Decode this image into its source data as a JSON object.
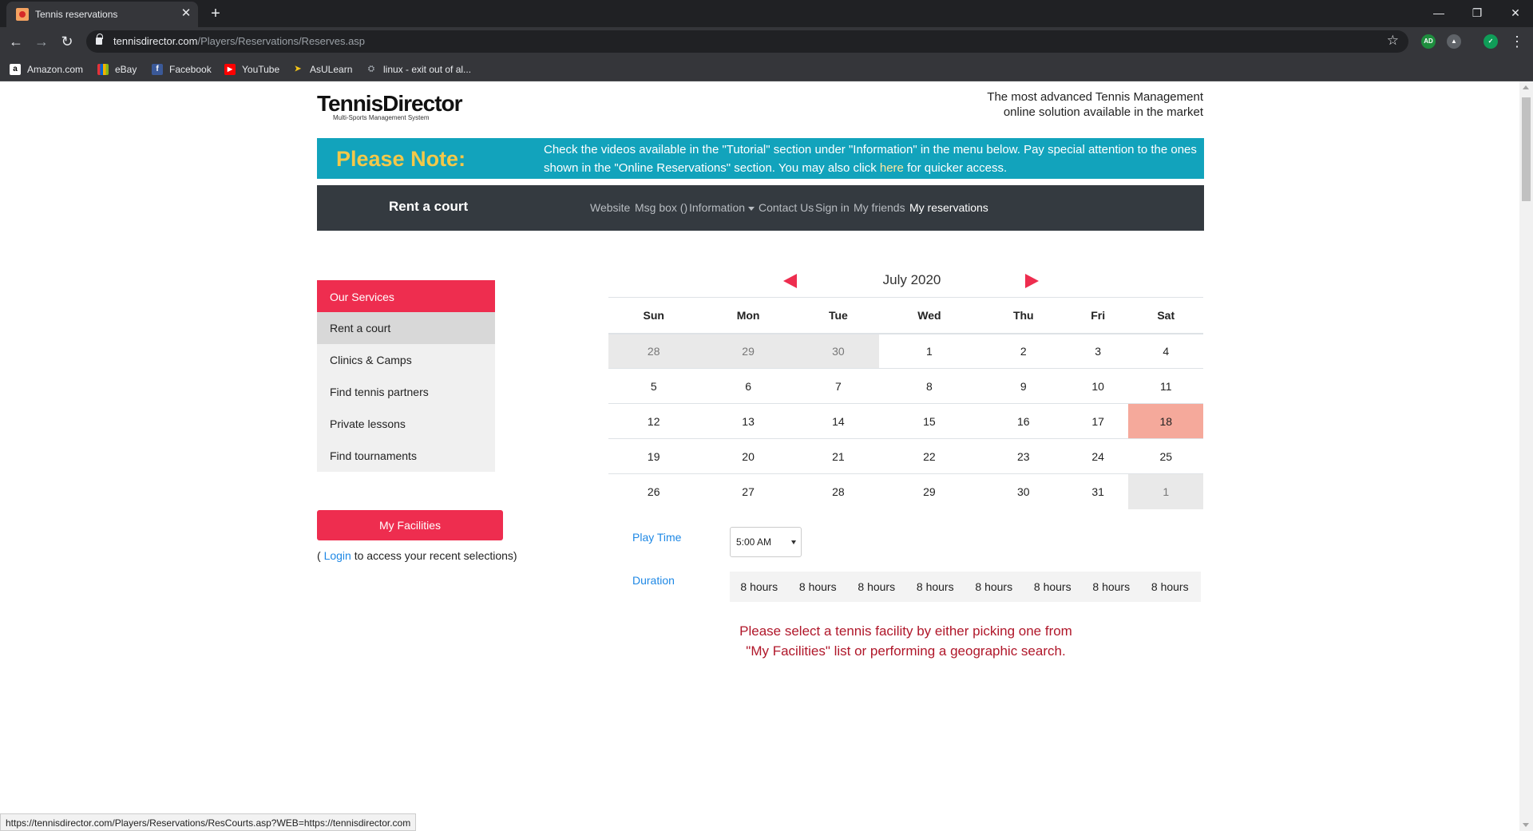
{
  "browser": {
    "tab_title": "Tennis reservations",
    "url_host": "tennisdirector.com",
    "url_path": "/Players/Reservations/Reserves.asp",
    "bookmarks": [
      "Amazon.com",
      "eBay",
      "Facebook",
      "YouTube",
      "AsULearn",
      "linux - exit out of al..."
    ]
  },
  "header": {
    "logo_text": "TennisDirector",
    "logo_sub": "Multi-Sports Management System",
    "tagline_line1": "The most advanced Tennis Management",
    "tagline_line2": "online solution available in the market"
  },
  "note": {
    "title": "Please Note:",
    "text_before": "Check the videos available in the \"Tutorial\" section under \"Information\" in the menu below. Pay special attention to the ones shown in the \"Online Reservations\" section. You may also click ",
    "link": "here",
    "text_after": " for quicker access."
  },
  "navbar": {
    "brand": "Rent a court",
    "items": [
      "Website",
      "Msg box ()",
      "Information",
      "Contact Us",
      "Sign in",
      "My friends",
      "My reservations"
    ]
  },
  "sidebar": {
    "heading": "Our Services",
    "items": [
      "Rent a court",
      "Clinics & Camps",
      "Find tennis partners",
      "Private lessons",
      "Find tournaments"
    ]
  },
  "facilities": {
    "button": "My Facilities",
    "login_prefix": "( ",
    "login_link": "Login",
    "login_suffix": "  to access your recent selections)"
  },
  "calendar": {
    "month": "July 2020",
    "days": [
      "Sun",
      "Mon",
      "Tue",
      "Wed",
      "Thu",
      "Fri",
      "Sat"
    ],
    "weeks": [
      [
        "28",
        "29",
        "30",
        "1",
        "2",
        "3",
        "4"
      ],
      [
        "5",
        "6",
        "7",
        "8",
        "9",
        "10",
        "11"
      ],
      [
        "12",
        "13",
        "14",
        "15",
        "16",
        "17",
        "18"
      ],
      [
        "19",
        "20",
        "21",
        "22",
        "23",
        "24",
        "25"
      ],
      [
        "26",
        "27",
        "28",
        "29",
        "30",
        "31",
        "1"
      ]
    ],
    "highlighted_day": "18"
  },
  "play_time": {
    "label": "Play Time",
    "value": "5:00 AM"
  },
  "duration": {
    "label": "Duration",
    "options": [
      "8 hours",
      "8 hours",
      "8 hours",
      "8 hours",
      "8 hours",
      "8 hours",
      "8 hours",
      "8 hours"
    ]
  },
  "message": {
    "line1": "Please select a tennis facility by either picking one from",
    "line2": "\"My Facilities\" list or performing a geographic search."
  },
  "status_url": "https://tennisdirector.com/Players/Reservations/ResCourts.asp?WEB=https://tennisdirector.com",
  "colors": {
    "accent_red": "#ee2d4f",
    "note_teal": "#12a3bc",
    "note_title_gold": "#f3c849",
    "navbar_dark": "#343a40",
    "today_highlight": "#f5a99b"
  }
}
